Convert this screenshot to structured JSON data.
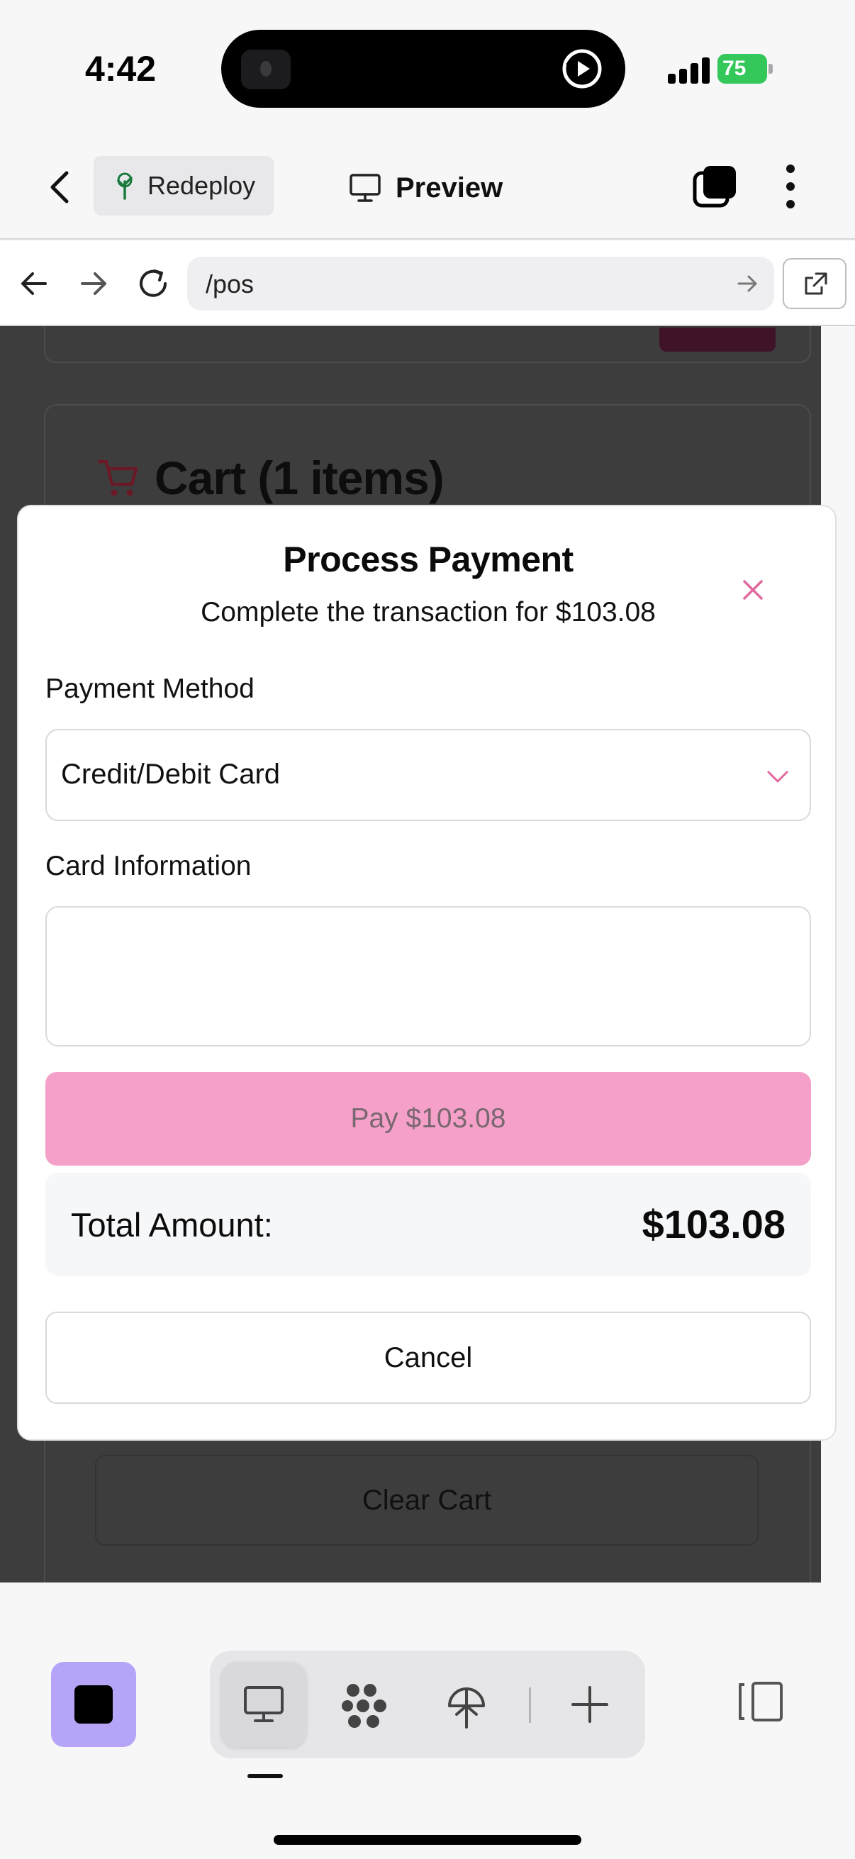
{
  "status_bar": {
    "time": "4:42",
    "battery": "75"
  },
  "header": {
    "redeploy_label": "Redeploy",
    "preview_label": "Preview"
  },
  "url_bar": {
    "path": "/pos"
  },
  "background": {
    "cart_title": "Cart (1 items)",
    "clear_cart_label": "Clear Cart"
  },
  "modal": {
    "title": "Process Payment",
    "subtitle": "Complete the transaction for $103.08",
    "payment_method_label": "Payment Method",
    "payment_method_value": "Credit/Debit Card",
    "card_info_label": "Card Information",
    "pay_button_label": "Pay $103.08",
    "total_label": "Total Amount:",
    "total_value": "$103.08",
    "cancel_label": "Cancel"
  },
  "colors": {
    "accent_pink": "#f5a0c9",
    "close_icon": "#e0699d",
    "toolbar_purple": "#b6a4f8",
    "battery_green": "#34c759"
  },
  "icons": {
    "status": [
      "play-icon",
      "signal-icon",
      "battery-icon"
    ],
    "header": [
      "back-icon",
      "tree-icon",
      "monitor-icon",
      "tabs-icon",
      "more-icon"
    ],
    "url": [
      "arrow-left-icon",
      "arrow-right-icon",
      "reload-icon",
      "go-icon",
      "external-link-icon"
    ],
    "toolbar": [
      "stop-icon",
      "desktop-icon",
      "nodes-icon",
      "deploy-icon",
      "plus-icon",
      "panel-icon"
    ]
  }
}
